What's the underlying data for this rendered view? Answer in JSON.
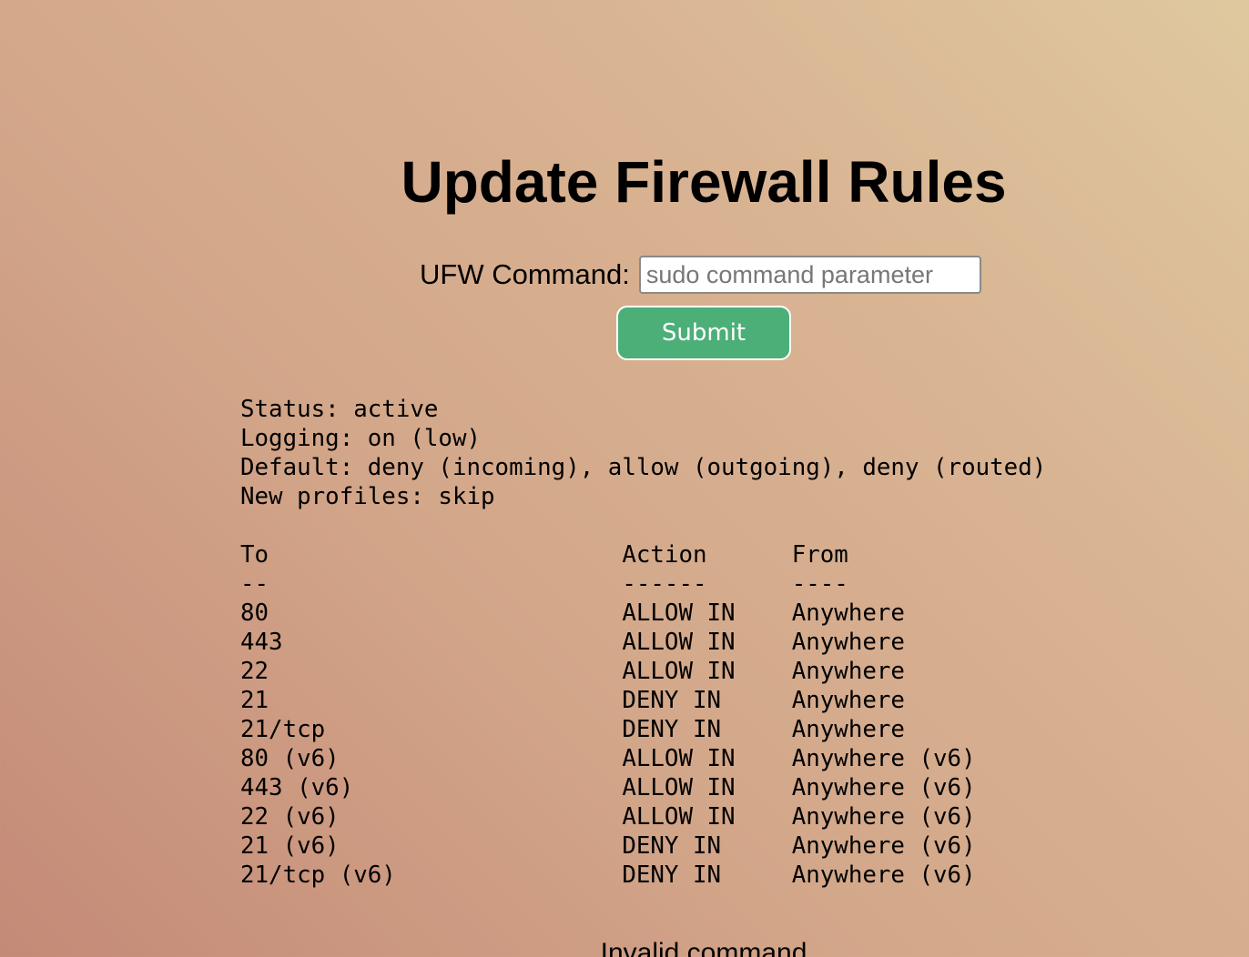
{
  "header": {
    "title": "Update Firewall Rules"
  },
  "form": {
    "command_label": "UFW Command:",
    "command_value": "",
    "command_placeholder": "sudo command parameter",
    "submit_label": "Submit"
  },
  "output": {
    "text": "Status: active\nLogging: on (low)\nDefault: deny (incoming), allow (outgoing), deny (routed)\nNew profiles: skip\n\nTo                         Action      From\n--                         ------      ----\n80                         ALLOW IN    Anywhere\n443                        ALLOW IN    Anywhere\n22                         ALLOW IN    Anywhere\n21                         DENY IN     Anywhere\n21/tcp                     DENY IN     Anywhere\n80 (v6)                    ALLOW IN    Anywhere (v6)\n443 (v6)                   ALLOW IN    Anywhere (v6)\n22 (v6)                    ALLOW IN    Anywhere (v6)\n21 (v6)                    DENY IN     Anywhere (v6)\n21/tcp (v6)                DENY IN     Anywhere (v6)"
  },
  "message": {
    "text": "Invalid command"
  }
}
